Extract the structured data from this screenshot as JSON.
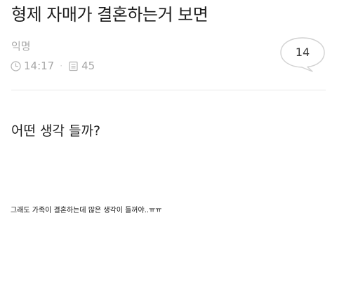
{
  "post": {
    "title": "형제 자매가 결혼하는거 보면",
    "author": "익명",
    "time": "14:17",
    "views": "45",
    "comment_count": "14",
    "question": "어떤 생각 들까?",
    "body": "그래도 가족이 결혼하는데 많은 생각이 들꺼야..ㅠㅠ"
  },
  "icons": {
    "time": "clock-icon",
    "views": "document-icon",
    "comments": "speech-bubble-icon"
  },
  "colors": {
    "meta_text": "#a6a6a6",
    "divider": "#e8e8e8",
    "bubble_border": "#d2d2d2"
  }
}
